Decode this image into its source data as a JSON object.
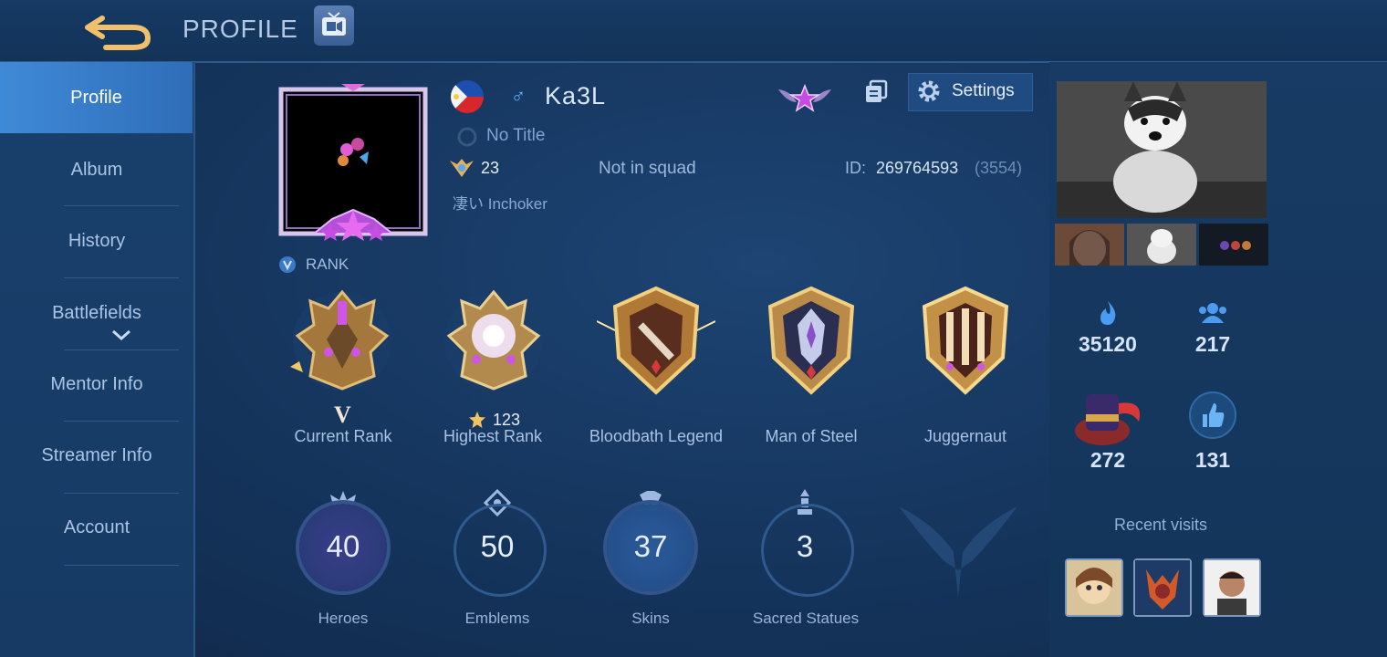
{
  "header": {
    "title": "PROFILE",
    "back_icon": "back-arrow-icon",
    "tv_icon": "tv-icon"
  },
  "sidebar": {
    "items": [
      {
        "label": "Profile",
        "active": true
      },
      {
        "label": "Album"
      },
      {
        "label": "History"
      },
      {
        "label": "Battlefields"
      },
      {
        "label": "Mentor Info"
      },
      {
        "label": "Streamer Info"
      },
      {
        "label": "Account"
      }
    ]
  },
  "profile": {
    "flag": "philippines-flag-icon",
    "gender": "♂",
    "username": "Ka3L",
    "title": "No Title",
    "level": "23",
    "squad": "Not in squad",
    "id_label": "ID:",
    "id_value": "269764593",
    "server": "(3554)",
    "tagline": "凄い Inchoker",
    "settings_label": "Settings",
    "rank_label": "RANK"
  },
  "badges": [
    {
      "label": "Current Rank",
      "sub": "V"
    },
    {
      "label": "Highest Rank",
      "sub": "123"
    },
    {
      "label": "Bloodbath Legend"
    },
    {
      "label": "Man of Steel"
    },
    {
      "label": "Juggernaut"
    }
  ],
  "stats": [
    {
      "value": "40",
      "label": "Heroes"
    },
    {
      "value": "50",
      "label": "Emblems"
    },
    {
      "value": "37",
      "label": "Skins"
    },
    {
      "value": "3",
      "label": "Sacred Statues"
    }
  ],
  "right_panel": {
    "popularity": "35120",
    "friends": "217",
    "collection": "272",
    "likes": "131",
    "recent_visits": "Recent visits"
  },
  "colors": {
    "accent": "#3f8ad8",
    "background": "#163760",
    "gold": "#d9a64a",
    "purple": "#b03bd6"
  }
}
